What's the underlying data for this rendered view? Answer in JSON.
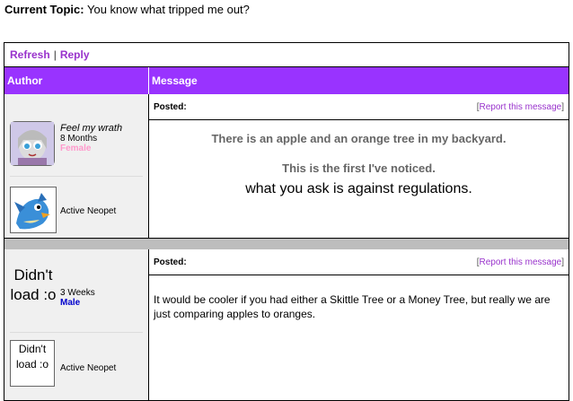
{
  "topic": {
    "label": "Current Topic:",
    "title": "You know what tripped me out?"
  },
  "actions": {
    "refresh": "Refresh",
    "separator": "|",
    "reply": "Reply"
  },
  "header": {
    "author": "Author",
    "message": "Message"
  },
  "posts": [
    {
      "username_line": "Feel my wrath",
      "member_since": "8 Months",
      "gender": "Female",
      "gender_color": "#ff99cc",
      "pet_status": "Active Neopet",
      "posted_label": "Posted:",
      "report_open": "[",
      "report_label": "Report this message",
      "report_close": "]",
      "message_lines": [
        "There is an apple and an orange tree in my backyard.",
        "This is the first I've noticed."
      ],
      "moderation_text": "what you ask is against regulations."
    },
    {
      "avatar_text": "Didn't load :o",
      "member_since": "3 Weeks",
      "gender": "Male",
      "gender_color": "#0000cc",
      "pet_image_text": "Didn't load :o",
      "pet_status": "Active Neopet",
      "posted_label": "Posted:",
      "report_open": "[",
      "report_label": "Report this message",
      "report_close": "]",
      "message": "It would be cooler if you had either a Skittle Tree or a Money Tree, but really we are just comparing apples to oranges."
    }
  ]
}
